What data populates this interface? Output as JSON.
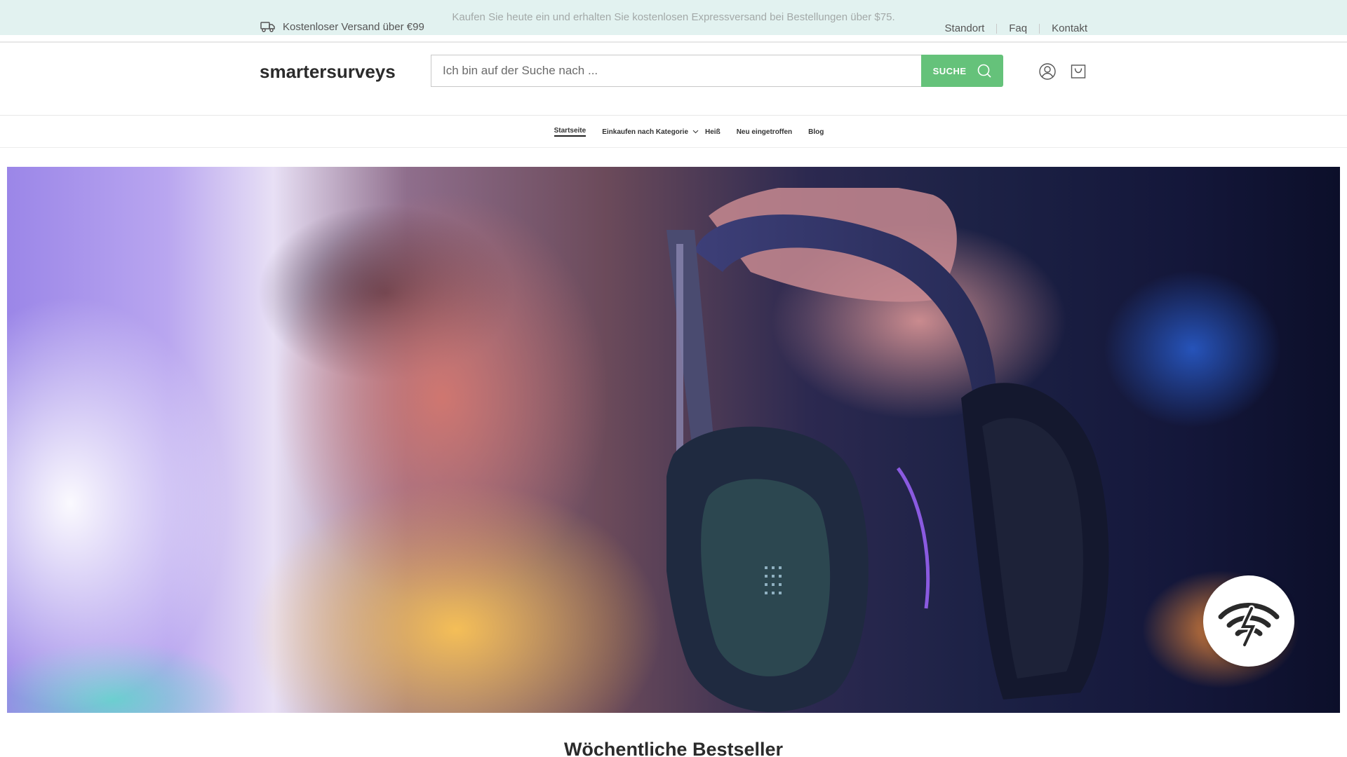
{
  "topbar": {
    "promo": "Kaufen Sie heute ein und erhalten Sie kostenlosen Expressversand bei Bestellungen über $75.",
    "shipping": "Kostenloser Versand über €99",
    "links": [
      "Standort",
      "Faq",
      "Kontakt"
    ]
  },
  "header": {
    "logo": "smartersurveys",
    "search_placeholder": "Ich bin auf der Suche nach ...",
    "search_button": "SUCHE"
  },
  "nav": {
    "items": [
      "Startseite",
      "Einkaufen nach Kategorie",
      "Heiß",
      "Neu eingetroffen",
      "Blog"
    ]
  },
  "main": {
    "section_title": "Wöchentliche Bestseller"
  },
  "colors": {
    "topbar_bg": "#e2f2f0",
    "accent": "#65c27a"
  },
  "icons": [
    "truck-icon",
    "search-icon",
    "user-icon",
    "cart-icon",
    "chevron-down-icon",
    "signal-badge-icon"
  ]
}
